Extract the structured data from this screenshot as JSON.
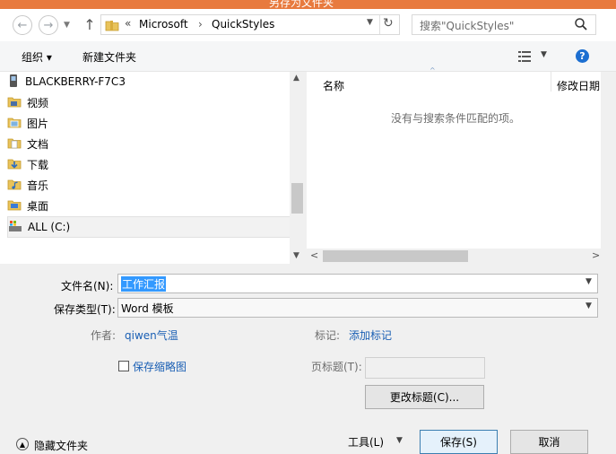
{
  "window": {
    "title": "另存为文件夹"
  },
  "nav": {
    "back_glyph": "←",
    "forward_glyph": "→",
    "up_glyph": "↑",
    "breadcrumb_sep": "«",
    "breadcrumb": [
      "Microsoft",
      "QuickStyles"
    ],
    "search_placeholder": "搜索\"QuickStyles\""
  },
  "toolbar": {
    "organize": "组织 ▾",
    "new_folder": "新建文件夹"
  },
  "tree": {
    "items": [
      {
        "label": "BLACKBERRY-F7C3",
        "icon": "device-icon"
      },
      {
        "label": "视频",
        "icon": "videos-folder-icon"
      },
      {
        "label": "图片",
        "icon": "pictures-folder-icon"
      },
      {
        "label": "文档",
        "icon": "documents-folder-icon"
      },
      {
        "label": "下载",
        "icon": "downloads-folder-icon"
      },
      {
        "label": "音乐",
        "icon": "music-folder-icon"
      },
      {
        "label": "桌面",
        "icon": "desktop-folder-icon"
      },
      {
        "label": "ALL (C:)",
        "icon": "drive-icon"
      }
    ]
  },
  "list": {
    "columns": [
      "名称",
      "修改日期"
    ],
    "empty_message": "没有与搜索条件匹配的项。"
  },
  "form": {
    "filename_label": "文件名(N):",
    "filename_value": "工作汇报",
    "filetype_label": "保存类型(T):",
    "filetype_value": "Word 模板",
    "author_label": "作者:",
    "author_value": "qiwen气温",
    "tags_label": "标记:",
    "tags_value": "添加标记",
    "thumbnail_label": "保存缩略图",
    "page_title_label": "页标题(T):",
    "change_title_button": "更改标题(C)...",
    "hide_folders": "隐藏文件夹",
    "tools_button": "工具(L)",
    "save_button": "保存(S)",
    "cancel_button": "取消"
  },
  "colors": {
    "accent": "#1a5fb4",
    "selection": "#3399ff",
    "titlebar": "#e87a3e"
  }
}
